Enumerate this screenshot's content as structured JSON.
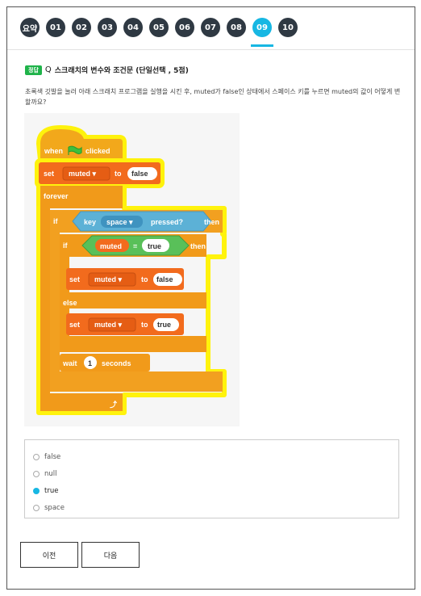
{
  "tabs": [
    {
      "label": "요약",
      "active": false
    },
    {
      "label": "01",
      "active": false
    },
    {
      "label": "02",
      "active": false
    },
    {
      "label": "03",
      "active": false
    },
    {
      "label": "04",
      "active": false
    },
    {
      "label": "05",
      "active": false
    },
    {
      "label": "06",
      "active": false
    },
    {
      "label": "07",
      "active": false
    },
    {
      "label": "08",
      "active": false
    },
    {
      "label": "09",
      "active": true
    },
    {
      "label": "10",
      "active": false
    }
  ],
  "question": {
    "badge": "정답",
    "marker": "Q",
    "title": "스크래치의 변수와 조건문 (단일선택 , 5점)",
    "text": "초록색 깃발을 눌러 아래 스크래치 프로그램을 실행을 시킨 후, muted가 false인 상태에서 스페이스 키를 누르면 muted의 값이 어떻게 변할까요?"
  },
  "scratch": {
    "when": "when",
    "clicked": "clicked",
    "set": "set",
    "to": "to",
    "var_muted": "muted ▾",
    "val_false": "false",
    "val_true": "true",
    "forever": "forever",
    "if": "if",
    "then": "then",
    "key": "key",
    "key_space": "space ▾",
    "pressed": "pressed?",
    "muted": "muted",
    "eq": "=",
    "else": "else",
    "wait": "wait",
    "wait_val": "1",
    "seconds": "seconds",
    "loop_arrow": "⤴"
  },
  "options": [
    {
      "label": "false",
      "selected": false
    },
    {
      "label": "null",
      "selected": false
    },
    {
      "label": "true",
      "selected": true
    },
    {
      "label": "space",
      "selected": false
    }
  ],
  "nav": {
    "prev": "이전",
    "next": "다음"
  },
  "colors": {
    "tab_dark": "#2f3943",
    "tab_active": "#17b7e3",
    "badge": "#1fb34a",
    "event_block": "#f2a81b",
    "control_block": "#f19a1a",
    "variable_block": "#f26b1d",
    "sensing_block": "#5cb1d6",
    "operator_block": "#59c059",
    "highlight": "#fff200"
  }
}
